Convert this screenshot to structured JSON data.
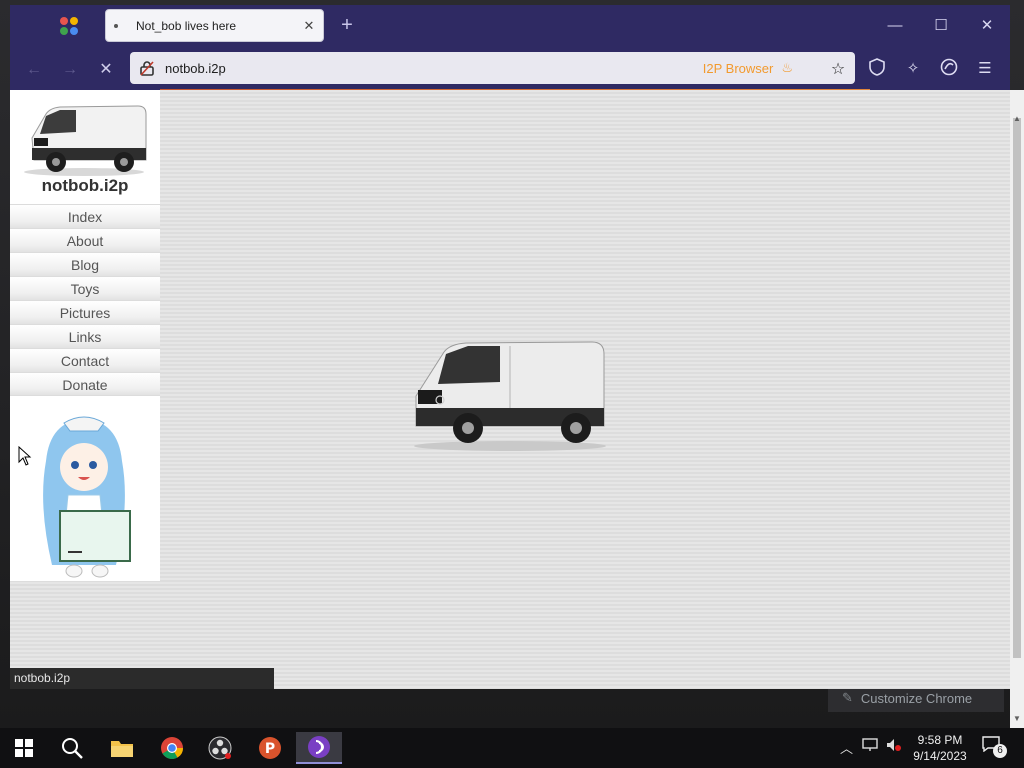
{
  "window": {
    "tab_title": "Not_bob lives here",
    "tab_close": "✕",
    "new_tab": "+",
    "minimize": "—",
    "maximize": "☐",
    "close": "✕"
  },
  "toolbar": {
    "url": "notbob.i2p",
    "i2p_badge": "I2P Browser",
    "back_icon": "←",
    "forward_icon": "→",
    "reload_icon": "✕",
    "bookmark_icon": "☆",
    "menu_icon": "☰"
  },
  "site": {
    "title": "notbob.i2p",
    "menu": [
      "Index",
      "About",
      "Blog",
      "Toys",
      "Pictures",
      "Links",
      "Contact",
      "Donate"
    ]
  },
  "status_url": "notbob.i2p",
  "customize_label": "Customize Chrome",
  "taskbar": {
    "time": "9:58 PM",
    "date": "9/14/2023",
    "notification_count": "6"
  }
}
